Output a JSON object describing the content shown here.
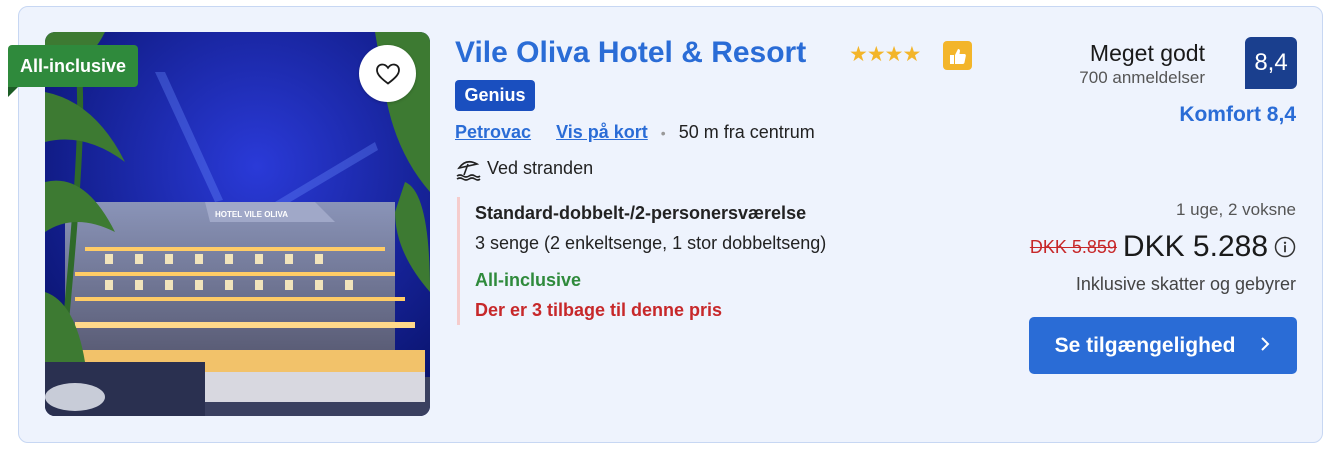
{
  "badge": {
    "label": "All-inclusive"
  },
  "hotel": {
    "name": "Vile Oliva Hotel & Resort",
    "stars": "★★★★",
    "genius_label": "Genius",
    "location_link": "Petrovac",
    "map_link": "Vis på kort",
    "distance": "50 m fra centrum",
    "beach": "Ved stranden",
    "photo_sign": "HOTEL VILE OLIVA"
  },
  "room": {
    "name": "Standard-dobbelt-/2-personersværelse",
    "beds": "3 senge (2 enkeltsenge, 1 stor dobbeltseng)",
    "meal_plan": "All-inclusive",
    "availability": "Der er 3 tilbage til denne pris"
  },
  "review": {
    "label": "Meget godt",
    "count": "700 anmeldelser",
    "score": "8,4",
    "comfort": "Komfort 8,4"
  },
  "pricing": {
    "stay": "1 uge, 2 voksne",
    "old_price": "DKK 5.859",
    "new_price": "DKK 5.288",
    "taxes": "Inklusive skatter og gebyrer"
  },
  "cta": {
    "label": "Se tilgængelighed"
  },
  "icons": [
    "heart-icon",
    "thumbs-up-icon",
    "beach-umbrella-icon",
    "info-icon",
    "chevron-right-icon"
  ],
  "colors": {
    "brand_blue": "#2a6cd6",
    "genius_blue": "#1a4fbf",
    "score_navy": "#1a3f8e",
    "green": "#2f8a3c",
    "red": "#c7282a",
    "star_yellow": "#f3b52a"
  }
}
